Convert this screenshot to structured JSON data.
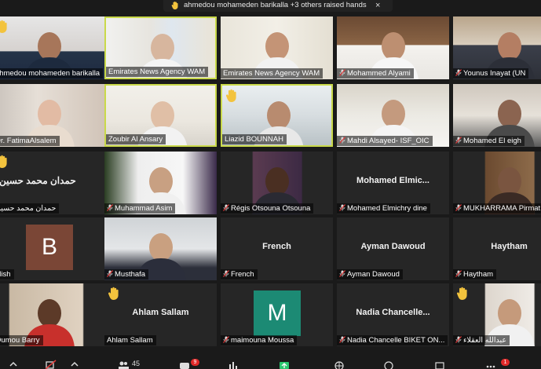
{
  "notification": {
    "text": "ahmedou mohameden barikalla +3 others raised hands",
    "close_glyph": "×"
  },
  "participants": [
    {
      "name": "ahmedou mohameden barikalla",
      "muted": false,
      "hand": true,
      "type": "video"
    },
    {
      "name": "Emirates News Agency WAM",
      "muted": false,
      "hand": false,
      "type": "video",
      "active": true
    },
    {
      "name": "Emirates News Agency WAM",
      "muted": false,
      "hand": false,
      "type": "video"
    },
    {
      "name": "Mohammed Alyami",
      "muted": true,
      "hand": false,
      "type": "video"
    },
    {
      "name": "Younus Inayat (UN",
      "muted": true,
      "hand": false,
      "type": "video"
    },
    {
      "name": "Dr. FatimaAlsalem",
      "muted": false,
      "hand": false,
      "type": "video"
    },
    {
      "name": "Zoubir Al Ansary",
      "muted": false,
      "hand": false,
      "type": "video",
      "active": true
    },
    {
      "name": "Liazid BOUNNAH",
      "muted": false,
      "hand": true,
      "type": "video",
      "active": true
    },
    {
      "name": "Mahdi Alsayed- ISF_OIC",
      "muted": true,
      "hand": false,
      "type": "video"
    },
    {
      "name": "Mohamed El eigh",
      "muted": true,
      "hand": false,
      "type": "video"
    },
    {
      "name": "حمدان محمد حسين",
      "muted": false,
      "hand": true,
      "type": "name",
      "display": "حمدان محمد حسين"
    },
    {
      "name": "Muhammad Asim",
      "muted": true,
      "hand": false,
      "type": "video"
    },
    {
      "name": "Régis Otsouna Otsouna",
      "muted": true,
      "hand": false,
      "type": "video"
    },
    {
      "name": "Mohamed Elmichry dine",
      "muted": true,
      "hand": false,
      "type": "name",
      "display": "Mohamed  Elmic..."
    },
    {
      "name": "MUKHARRAMA Pirmat",
      "muted": true,
      "hand": false,
      "type": "video"
    },
    {
      "name": "glish",
      "muted": false,
      "hand": false,
      "type": "avatar",
      "initial": "B"
    },
    {
      "name": "Musthafa",
      "muted": true,
      "hand": false,
      "type": "video"
    },
    {
      "name": "French",
      "muted": true,
      "hand": false,
      "type": "name",
      "display": "French"
    },
    {
      "name": "Ayman Dawoud",
      "muted": true,
      "hand": false,
      "type": "name",
      "display": "Ayman Dawoud"
    },
    {
      "name": "Haytham",
      "muted": true,
      "hand": false,
      "type": "name",
      "display": "Haytham"
    },
    {
      "name": "Oumou Barry",
      "muted": false,
      "hand": false,
      "type": "video"
    },
    {
      "name": "Ahlam Sallam",
      "muted": false,
      "hand": true,
      "type": "name",
      "display": "Ahlam Sallam"
    },
    {
      "name": "maimouna Moussa",
      "muted": true,
      "hand": false,
      "type": "avatar",
      "initial": "M"
    },
    {
      "name": "Nadia Chancelle BIKET ON...",
      "muted": true,
      "hand": false,
      "type": "name",
      "display": "Nadia  Chancelle..."
    },
    {
      "name": "عبدالله العقلاء",
      "muted": true,
      "hand": true,
      "type": "video"
    }
  ],
  "toolbar": {
    "participants_count": "45",
    "chat_badge": "9",
    "more_badge": "1"
  },
  "colors": {
    "avatar_B": "#7a4636",
    "avatar_M": "#1c8a74",
    "mute_red": "#e23b3b",
    "hand_yellow": "#f3c33d",
    "active_border": "#c9d94a"
  }
}
